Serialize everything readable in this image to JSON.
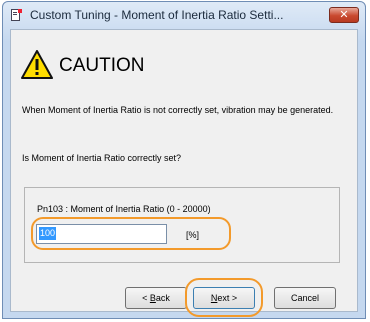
{
  "window": {
    "title": "Custom Tuning - Moment of Inertia Ratio Setti..."
  },
  "caution": {
    "heading": "CAUTION"
  },
  "messages": {
    "warning": "When Moment of Inertia Ratio is not correctly set, vibration may be generated.",
    "question": "Is Moment of Inertia Ratio correctly set?"
  },
  "parameter": {
    "label": "Pn103 : Moment of Inertia Ratio (0 - 20000)",
    "value": "100",
    "unit": "[%]"
  },
  "buttons": {
    "back_prefix": "< ",
    "back_mnemonic": "B",
    "back_rest": "ack",
    "next_mnemonic": "N",
    "next_rest": "ext >",
    "cancel": "Cancel"
  },
  "colors": {
    "highlight": "#f39a2b",
    "warning_yellow": "#ffdd00",
    "selection": "#3399ff"
  }
}
